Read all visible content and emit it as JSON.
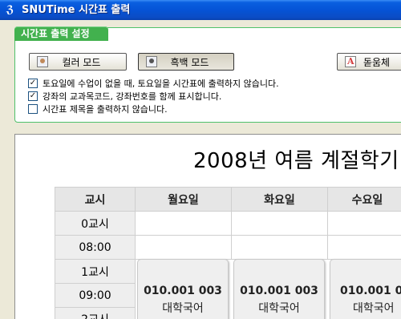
{
  "window": {
    "title": "SNUTime 시간표 출력",
    "icon": "snutime-app-icon"
  },
  "settings": {
    "tab_label": "시간표 출력 설정",
    "buttons": {
      "color_mode": "컬러 모드",
      "bw_mode": "흑백 모드",
      "font": "돋움체"
    },
    "options": [
      {
        "label": "토요일에 수업이 없을 때, 토요일을 시간표에 출력하지 않습니다.",
        "checked": true
      },
      {
        "label": "강좌의 교과목코드, 강좌번호를 함께 표시합니다.",
        "checked": true
      },
      {
        "label": "시간표 제목을 출력하지 않습니다.",
        "checked": false
      }
    ]
  },
  "preview": {
    "title": "2008년 여름 계절학기",
    "headers": [
      "교시",
      "월요일",
      "화요일",
      "수요일"
    ],
    "time_rows": [
      "0교시",
      "08:00",
      "1교시",
      "09:00",
      "2교시"
    ],
    "courses": [
      {
        "code": "010.001 003",
        "name": "대학국어"
      },
      {
        "code": "010.001 003",
        "name": "대학국어"
      },
      {
        "code": "010.001 003",
        "name": "대학국어"
      }
    ]
  }
}
